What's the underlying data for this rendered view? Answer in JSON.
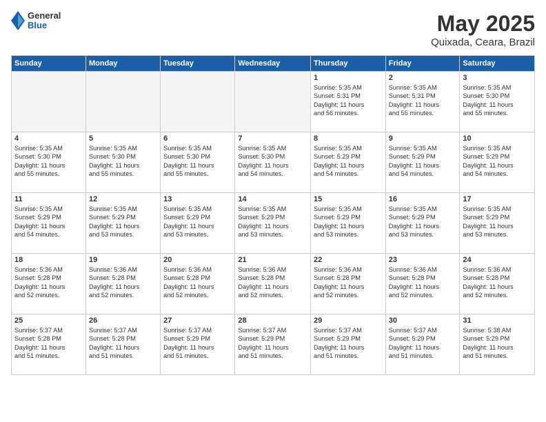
{
  "header": {
    "logo_general": "General",
    "logo_blue": "Blue",
    "title": "May 2025",
    "subtitle": "Quixada, Ceara, Brazil"
  },
  "calendar": {
    "days_of_week": [
      "Sunday",
      "Monday",
      "Tuesday",
      "Wednesday",
      "Thursday",
      "Friday",
      "Saturday"
    ],
    "weeks": [
      [
        {
          "day": "",
          "info": ""
        },
        {
          "day": "",
          "info": ""
        },
        {
          "day": "",
          "info": ""
        },
        {
          "day": "",
          "info": ""
        },
        {
          "day": "1",
          "info": "Sunrise: 5:35 AM\nSunset: 5:31 PM\nDaylight: 11 hours\nand 56 minutes."
        },
        {
          "day": "2",
          "info": "Sunrise: 5:35 AM\nSunset: 5:31 PM\nDaylight: 11 hours\nand 55 minutes."
        },
        {
          "day": "3",
          "info": "Sunrise: 5:35 AM\nSunset: 5:30 PM\nDaylight: 11 hours\nand 55 minutes."
        }
      ],
      [
        {
          "day": "4",
          "info": "Sunrise: 5:35 AM\nSunset: 5:30 PM\nDaylight: 11 hours\nand 55 minutes."
        },
        {
          "day": "5",
          "info": "Sunrise: 5:35 AM\nSunset: 5:30 PM\nDaylight: 11 hours\nand 55 minutes."
        },
        {
          "day": "6",
          "info": "Sunrise: 5:35 AM\nSunset: 5:30 PM\nDaylight: 11 hours\nand 55 minutes."
        },
        {
          "day": "7",
          "info": "Sunrise: 5:35 AM\nSunset: 5:30 PM\nDaylight: 11 hours\nand 54 minutes."
        },
        {
          "day": "8",
          "info": "Sunrise: 5:35 AM\nSunset: 5:29 PM\nDaylight: 11 hours\nand 54 minutes."
        },
        {
          "day": "9",
          "info": "Sunrise: 5:35 AM\nSunset: 5:29 PM\nDaylight: 11 hours\nand 54 minutes."
        },
        {
          "day": "10",
          "info": "Sunrise: 5:35 AM\nSunset: 5:29 PM\nDaylight: 11 hours\nand 54 minutes."
        }
      ],
      [
        {
          "day": "11",
          "info": "Sunrise: 5:35 AM\nSunset: 5:29 PM\nDaylight: 11 hours\nand 54 minutes."
        },
        {
          "day": "12",
          "info": "Sunrise: 5:35 AM\nSunset: 5:29 PM\nDaylight: 11 hours\nand 53 minutes."
        },
        {
          "day": "13",
          "info": "Sunrise: 5:35 AM\nSunset: 5:29 PM\nDaylight: 11 hours\nand 53 minutes."
        },
        {
          "day": "14",
          "info": "Sunrise: 5:35 AM\nSunset: 5:29 PM\nDaylight: 11 hours\nand 53 minutes."
        },
        {
          "day": "15",
          "info": "Sunrise: 5:35 AM\nSunset: 5:29 PM\nDaylight: 11 hours\nand 53 minutes."
        },
        {
          "day": "16",
          "info": "Sunrise: 5:35 AM\nSunset: 5:29 PM\nDaylight: 11 hours\nand 53 minutes."
        },
        {
          "day": "17",
          "info": "Sunrise: 5:35 AM\nSunset: 5:29 PM\nDaylight: 11 hours\nand 53 minutes."
        }
      ],
      [
        {
          "day": "18",
          "info": "Sunrise: 5:36 AM\nSunset: 5:28 PM\nDaylight: 11 hours\nand 52 minutes."
        },
        {
          "day": "19",
          "info": "Sunrise: 5:36 AM\nSunset: 5:28 PM\nDaylight: 11 hours\nand 52 minutes."
        },
        {
          "day": "20",
          "info": "Sunrise: 5:36 AM\nSunset: 5:28 PM\nDaylight: 11 hours\nand 52 minutes."
        },
        {
          "day": "21",
          "info": "Sunrise: 5:36 AM\nSunset: 5:28 PM\nDaylight: 11 hours\nand 52 minutes."
        },
        {
          "day": "22",
          "info": "Sunrise: 5:36 AM\nSunset: 5:28 PM\nDaylight: 11 hours\nand 52 minutes."
        },
        {
          "day": "23",
          "info": "Sunrise: 5:36 AM\nSunset: 5:28 PM\nDaylight: 11 hours\nand 52 minutes."
        },
        {
          "day": "24",
          "info": "Sunrise: 5:36 AM\nSunset: 5:28 PM\nDaylight: 11 hours\nand 52 minutes."
        }
      ],
      [
        {
          "day": "25",
          "info": "Sunrise: 5:37 AM\nSunset: 5:28 PM\nDaylight: 11 hours\nand 51 minutes."
        },
        {
          "day": "26",
          "info": "Sunrise: 5:37 AM\nSunset: 5:28 PM\nDaylight: 11 hours\nand 51 minutes."
        },
        {
          "day": "27",
          "info": "Sunrise: 5:37 AM\nSunset: 5:29 PM\nDaylight: 11 hours\nand 51 minutes."
        },
        {
          "day": "28",
          "info": "Sunrise: 5:37 AM\nSunset: 5:29 PM\nDaylight: 11 hours\nand 51 minutes."
        },
        {
          "day": "29",
          "info": "Sunrise: 5:37 AM\nSunset: 5:29 PM\nDaylight: 11 hours\nand 51 minutes."
        },
        {
          "day": "30",
          "info": "Sunrise: 5:37 AM\nSunset: 5:29 PM\nDaylight: 11 hours\nand 51 minutes."
        },
        {
          "day": "31",
          "info": "Sunrise: 5:38 AM\nSunset: 5:29 PM\nDaylight: 11 hours\nand 51 minutes."
        }
      ]
    ]
  }
}
